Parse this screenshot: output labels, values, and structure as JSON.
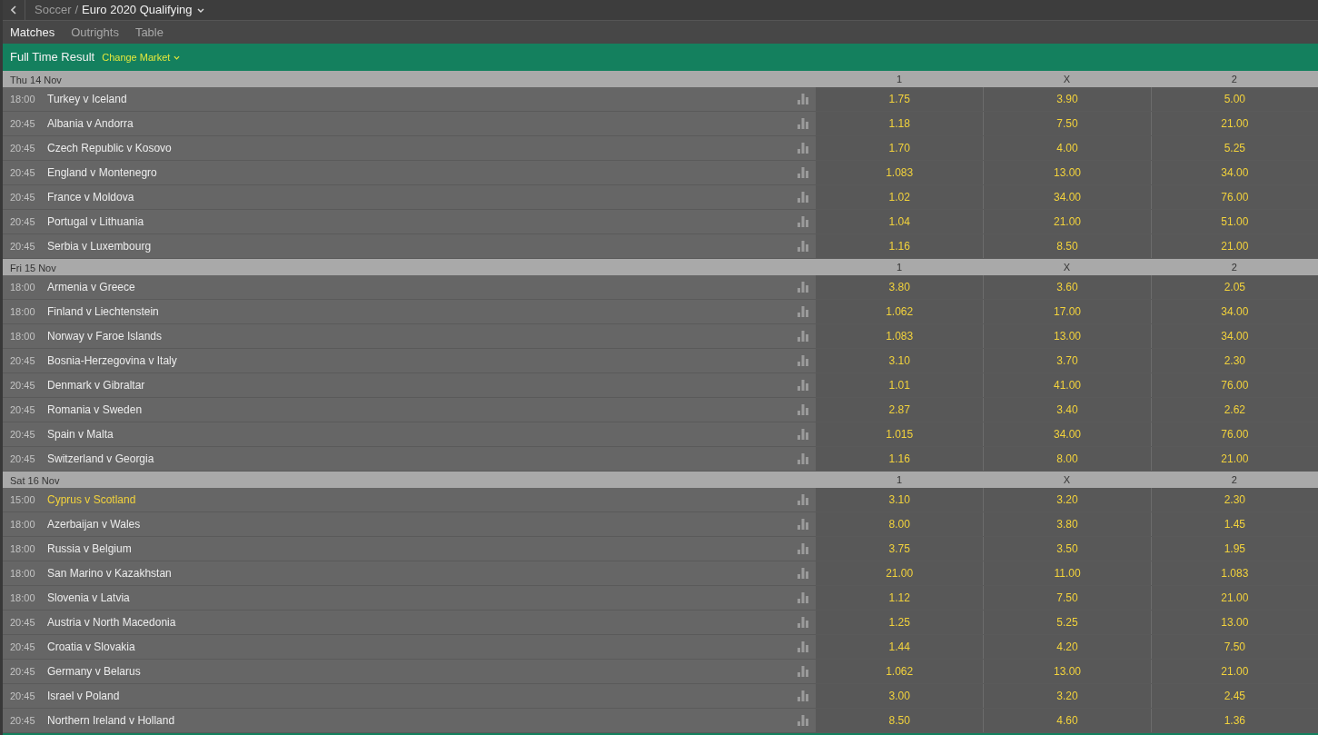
{
  "breadcrumb": {
    "parent": "Soccer",
    "separator": "/",
    "current": "Euro 2020 Qualifying"
  },
  "tabs": [
    {
      "label": "Matches",
      "selected": true
    },
    {
      "label": "Outrights",
      "selected": false
    },
    {
      "label": "Table",
      "selected": false
    }
  ],
  "market": {
    "title": "Full Time Result",
    "change_label": "Change Market"
  },
  "days": [
    {
      "date": "Thu 14 Nov",
      "columns": [
        "1",
        "X",
        "2"
      ],
      "matches": [
        {
          "time": "18:00",
          "teams": "Turkey v Iceland",
          "highlighted": false,
          "odds": [
            "1.75",
            "3.90",
            "5.00"
          ]
        },
        {
          "time": "20:45",
          "teams": "Albania v Andorra",
          "highlighted": false,
          "odds": [
            "1.18",
            "7.50",
            "21.00"
          ]
        },
        {
          "time": "20:45",
          "teams": "Czech Republic v Kosovo",
          "highlighted": false,
          "odds": [
            "1.70",
            "4.00",
            "5.25"
          ]
        },
        {
          "time": "20:45",
          "teams": "England v Montenegro",
          "highlighted": false,
          "odds": [
            "1.083",
            "13.00",
            "34.00"
          ]
        },
        {
          "time": "20:45",
          "teams": "France v Moldova",
          "highlighted": false,
          "odds": [
            "1.02",
            "34.00",
            "76.00"
          ]
        },
        {
          "time": "20:45",
          "teams": "Portugal v Lithuania",
          "highlighted": false,
          "odds": [
            "1.04",
            "21.00",
            "51.00"
          ]
        },
        {
          "time": "20:45",
          "teams": "Serbia v Luxembourg",
          "highlighted": false,
          "odds": [
            "1.16",
            "8.50",
            "21.00"
          ]
        }
      ]
    },
    {
      "date": "Fri 15 Nov",
      "columns": [
        "1",
        "X",
        "2"
      ],
      "matches": [
        {
          "time": "18:00",
          "teams": "Armenia v Greece",
          "highlighted": false,
          "odds": [
            "3.80",
            "3.60",
            "2.05"
          ]
        },
        {
          "time": "18:00",
          "teams": "Finland v Liechtenstein",
          "highlighted": false,
          "odds": [
            "1.062",
            "17.00",
            "34.00"
          ]
        },
        {
          "time": "18:00",
          "teams": "Norway v Faroe Islands",
          "highlighted": false,
          "odds": [
            "1.083",
            "13.00",
            "34.00"
          ]
        },
        {
          "time": "20:45",
          "teams": "Bosnia-Herzegovina v Italy",
          "highlighted": false,
          "odds": [
            "3.10",
            "3.70",
            "2.30"
          ]
        },
        {
          "time": "20:45",
          "teams": "Denmark v Gibraltar",
          "highlighted": false,
          "odds": [
            "1.01",
            "41.00",
            "76.00"
          ]
        },
        {
          "time": "20:45",
          "teams": "Romania v Sweden",
          "highlighted": false,
          "odds": [
            "2.87",
            "3.40",
            "2.62"
          ]
        },
        {
          "time": "20:45",
          "teams": "Spain v Malta",
          "highlighted": false,
          "odds": [
            "1.015",
            "34.00",
            "76.00"
          ]
        },
        {
          "time": "20:45",
          "teams": "Switzerland v Georgia",
          "highlighted": false,
          "odds": [
            "1.16",
            "8.00",
            "21.00"
          ]
        }
      ]
    },
    {
      "date": "Sat 16 Nov",
      "columns": [
        "1",
        "X",
        "2"
      ],
      "matches": [
        {
          "time": "15:00",
          "teams": "Cyprus v Scotland",
          "highlighted": true,
          "odds": [
            "3.10",
            "3.20",
            "2.30"
          ]
        },
        {
          "time": "18:00",
          "teams": "Azerbaijan v Wales",
          "highlighted": false,
          "odds": [
            "8.00",
            "3.80",
            "1.45"
          ]
        },
        {
          "time": "18:00",
          "teams": "Russia v Belgium",
          "highlighted": false,
          "odds": [
            "3.75",
            "3.50",
            "1.95"
          ]
        },
        {
          "time": "18:00",
          "teams": "San Marino v Kazakhstan",
          "highlighted": false,
          "odds": [
            "21.00",
            "11.00",
            "1.083"
          ]
        },
        {
          "time": "18:00",
          "teams": "Slovenia v Latvia",
          "highlighted": false,
          "odds": [
            "1.12",
            "7.50",
            "21.00"
          ]
        },
        {
          "time": "20:45",
          "teams": "Austria v North Macedonia",
          "highlighted": false,
          "odds": [
            "1.25",
            "5.25",
            "13.00"
          ]
        },
        {
          "time": "20:45",
          "teams": "Croatia v Slovakia",
          "highlighted": false,
          "odds": [
            "1.44",
            "4.20",
            "7.50"
          ]
        },
        {
          "time": "20:45",
          "teams": "Germany v Belarus",
          "highlighted": false,
          "odds": [
            "1.062",
            "13.00",
            "21.00"
          ]
        },
        {
          "time": "20:45",
          "teams": "Israel v Poland",
          "highlighted": false,
          "odds": [
            "3.00",
            "3.20",
            "2.45"
          ]
        },
        {
          "time": "20:45",
          "teams": "Northern Ireland v Holland",
          "highlighted": false,
          "odds": [
            "8.50",
            "4.60",
            "1.36"
          ]
        }
      ]
    }
  ]
}
